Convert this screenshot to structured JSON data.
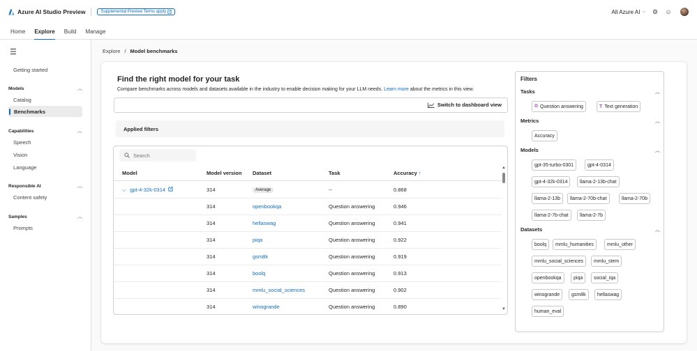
{
  "app": {
    "title": "Azure AI Studio Preview",
    "preview_badge": "Supplemental Preview Terms apply",
    "scope": "All Azure AI",
    "brand_color": "#0f6cbd"
  },
  "tabs": [
    {
      "label": "Home"
    },
    {
      "label": "Explore",
      "active": true
    },
    {
      "label": "Build"
    },
    {
      "label": "Manage"
    }
  ],
  "sidebar": {
    "getting_started": "Getting started",
    "sections": [
      {
        "title": "Models",
        "items": [
          "Catalog",
          "Benchmarks"
        ]
      },
      {
        "title": "Capabilities",
        "items": [
          "Speech",
          "Vision",
          "Language"
        ]
      },
      {
        "title": "Responsible AI",
        "items": [
          "Content safety"
        ]
      },
      {
        "title": "Samples",
        "items": [
          "Prompts"
        ]
      }
    ],
    "selected": "Benchmarks"
  },
  "breadcrumb": {
    "parent": "Explore",
    "separator": "/",
    "current": "Model benchmarks"
  },
  "main": {
    "title": "Find the right model for your task",
    "description_before": "Compare benchmarks across models and datasets available in the industry to enable decision making for your LLM needs.",
    "learn_more": "Learn more",
    "description_after": "about the metrics in this view.",
    "switch_label": "Switch to dashboard view",
    "applied_filters": "Applied filters",
    "search_placeholder": "Search"
  },
  "table": {
    "columns": [
      "Model",
      "Model version",
      "Dataset",
      "Task",
      "Accuracy"
    ],
    "sort_indicator": "↑",
    "rows": [
      {
        "model": "gpt-4-32k-0314",
        "version": "314",
        "dataset": "Average",
        "task": "--",
        "accuracy": "0.868"
      },
      {
        "model": "",
        "version": "314",
        "dataset": "openbookqa",
        "task": "Question answering",
        "accuracy": "0.946"
      },
      {
        "model": "",
        "version": "314",
        "dataset": "hellaswag",
        "task": "Question answering",
        "accuracy": "0.941"
      },
      {
        "model": "",
        "version": "314",
        "dataset": "piqa",
        "task": "Question answering",
        "accuracy": "0.922"
      },
      {
        "model": "",
        "version": "314",
        "dataset": "gsm8k",
        "task": "Question answering",
        "accuracy": "0.919"
      },
      {
        "model": "",
        "version": "314",
        "dataset": "boolq",
        "task": "Question answering",
        "accuracy": "0.913"
      },
      {
        "model": "",
        "version": "314",
        "dataset": "mmlu_social_sciences",
        "task": "Question answering",
        "accuracy": "0.902"
      },
      {
        "model": "",
        "version": "314",
        "dataset": "winogrande",
        "task": "Question answering",
        "accuracy": "0.890"
      }
    ]
  },
  "filters": {
    "title": "Filters",
    "tasks_title": "Tasks",
    "tasks": [
      "Question answering",
      "Text generation"
    ],
    "metrics_title": "Metrics",
    "metrics": [
      "Accuracy"
    ],
    "models_title": "Models",
    "models": [
      "gpt-35-turbo-0301",
      "gpt-4-0314",
      "gpt-4-32k-0314",
      "llama-2-13b-chat",
      "llama-2-13b",
      "llama-2-70b-chat",
      "llama-2-70b",
      "llama-2-7b-chat",
      "llama-2-7b"
    ],
    "datasets_title": "Datasets",
    "datasets": [
      "boolq",
      "mmlu_humanities",
      "mmlu_other",
      "mmlu_social_sciences",
      "mmlu_stem",
      "openbookqa",
      "piqa",
      "social_iqa",
      "winogrande",
      "gsm8k",
      "hellaswag",
      "human_eval"
    ]
  }
}
